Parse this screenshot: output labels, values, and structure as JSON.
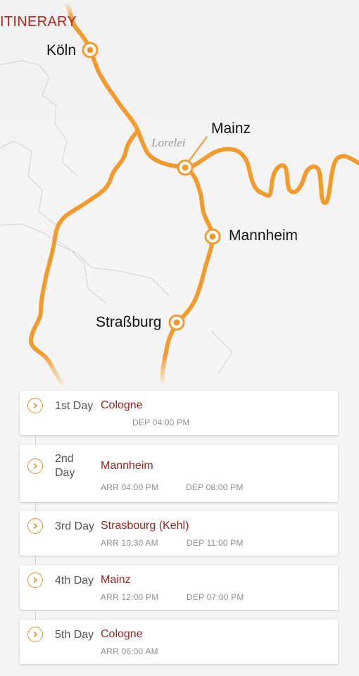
{
  "header": {
    "title": "ITINERARY"
  },
  "map": {
    "route_color": "#f39a2c",
    "cities": [
      "Köln",
      "Mainz",
      "Mannheim",
      "Straßburg"
    ],
    "landmark": "Lorelei"
  },
  "itinerary": [
    {
      "day": "1st Day",
      "city": "Cologne",
      "arr": "",
      "dep": "DEP 04:00 PM"
    },
    {
      "day": "2nd Day",
      "city": "Mannheim",
      "arr": "ARR 04:00 PM",
      "dep": "DEP 08:00 PM"
    },
    {
      "day": "3rd Day",
      "city": "Strasbourg (Kehl)",
      "arr": "ARR 10:30 AM",
      "dep": "DEP 11:00 PM"
    },
    {
      "day": "4th Day",
      "city": "Mainz",
      "arr": "ARR 12:00 PM",
      "dep": "DEP 07:00 PM"
    },
    {
      "day": "5th Day",
      "city": "Cologne",
      "arr": "ARR 06:00 AM",
      "dep": ""
    }
  ],
  "icons": {
    "expand": "chevron-right-icon",
    "stop": "map-pin-ring-icon"
  }
}
